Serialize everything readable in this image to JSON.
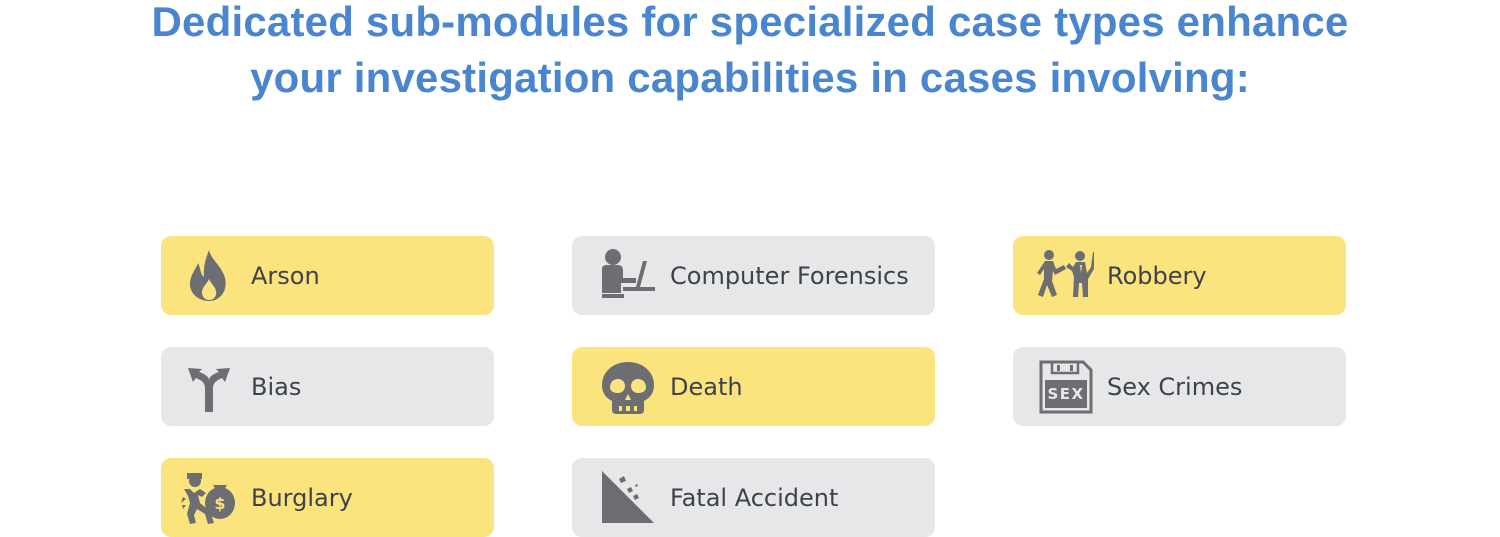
{
  "headline": {
    "line1": "Dedicated sub-modules for specialized case types enhance",
    "line2": "your investigation capabilities in cases involving:"
  },
  "colors": {
    "headline": "#4a86cf",
    "card_yellow": "#fbe47e",
    "card_gray": "#e6e7e8",
    "icon": "#6d6e71",
    "label": "#3f4349"
  },
  "case_types": [
    {
      "label": "Arson",
      "icon": "flame-icon",
      "color": "yellow"
    },
    {
      "label": "Computer Forensics",
      "icon": "person-at-laptop-icon",
      "color": "gray"
    },
    {
      "label": "Robbery",
      "icon": "robbery-figures-icon",
      "color": "yellow"
    },
    {
      "label": "Bias",
      "icon": "diverging-arrows-icon",
      "color": "gray"
    },
    {
      "label": "Death",
      "icon": "skull-icon",
      "color": "yellow"
    },
    {
      "label": "Sex Crimes",
      "icon": "sex-tape-icon",
      "color": "gray"
    },
    {
      "label": "Burglary",
      "icon": "burglar-with-money-bag-icon",
      "color": "yellow"
    },
    {
      "label": "Fatal Accident",
      "icon": "falling-rocks-slope-icon",
      "color": "gray"
    }
  ],
  "icon_text": {
    "sex_tape": "SEX",
    "money_bag": "$"
  }
}
